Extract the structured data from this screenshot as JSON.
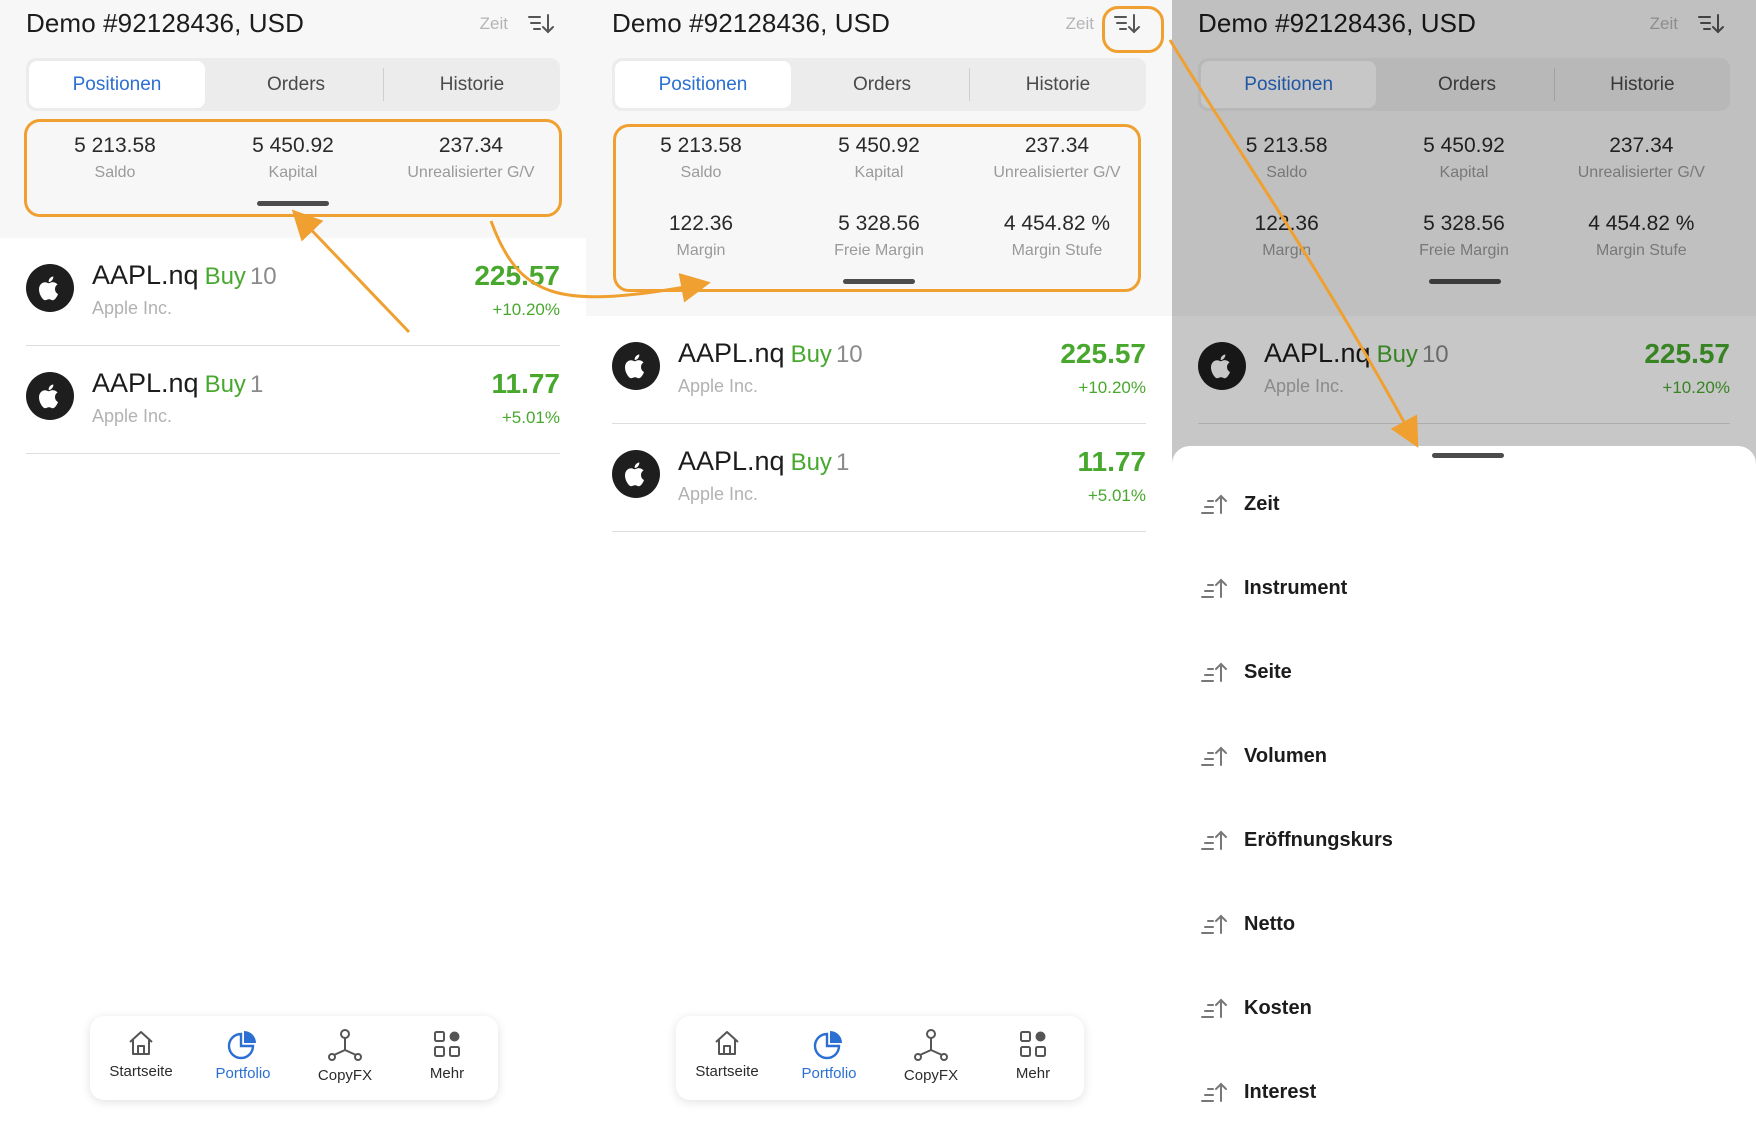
{
  "account_title": "Demo #92128436, USD",
  "sort_label": "Zeit",
  "tabs": [
    "Positionen",
    "Orders",
    "Historie"
  ],
  "summary": {
    "saldo": {
      "value": "5 213.58",
      "label": "Saldo"
    },
    "kapital": {
      "value": "5 450.92",
      "label": "Kapital"
    },
    "unrealized": {
      "value": "237.34",
      "label": "Unrealisierter G/V"
    },
    "margin": {
      "value": "122.36",
      "label": "Margin"
    },
    "free_margin": {
      "value": "5 328.56",
      "label": "Freie Margin"
    },
    "margin_level": {
      "value": "4 454.82 %",
      "label": "Margin Stufe"
    }
  },
  "positions": [
    {
      "symbol": "AAPL.nq",
      "side": "Buy",
      "qty": "10",
      "name": "Apple Inc.",
      "price": "225.57",
      "change": "+10.20%"
    },
    {
      "symbol": "AAPL.nq",
      "side": "Buy",
      "qty": "1",
      "name": "Apple Inc.",
      "price": "11.77",
      "change": "+5.01%"
    }
  ],
  "nav": [
    {
      "label": "Startseite",
      "icon": "home-icon"
    },
    {
      "label": "Portfolio",
      "icon": "pie-chart-icon"
    },
    {
      "label": "CopyFX",
      "icon": "network-icon"
    },
    {
      "label": "Mehr",
      "icon": "grid-icon"
    }
  ],
  "sort_options": [
    "Zeit",
    "Instrument",
    "Seite",
    "Volumen",
    "Eröffnungskurs",
    "Netto",
    "Kosten",
    "Interest"
  ],
  "colors": {
    "accent": "#2b6fd3",
    "positive": "#48a82e",
    "annotation": "#f0a030"
  }
}
